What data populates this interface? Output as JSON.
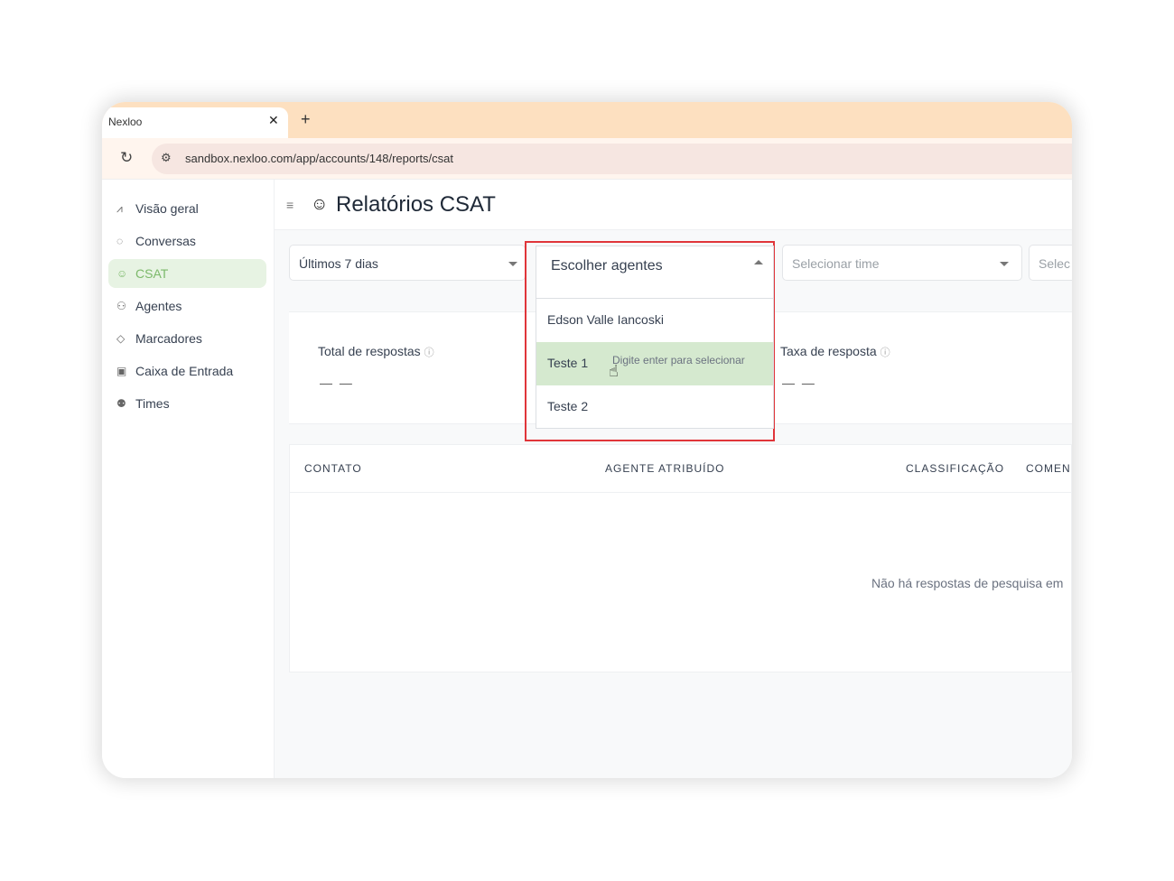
{
  "browser": {
    "tab_title": "Nexloo",
    "close_glyph": "✕",
    "new_tab_glyph": "+",
    "reload_glyph": "↻",
    "site_settings_glyph": "⚙",
    "url": "sandbox.nexloo.com/app/accounts/148/reports/csat"
  },
  "sidebar": {
    "items": [
      {
        "label": "Visão geral",
        "icon": "⩘"
      },
      {
        "label": "Conversas",
        "icon": "◌"
      },
      {
        "label": "CSAT",
        "icon": "☺"
      },
      {
        "label": "Agentes",
        "icon": "⚇"
      },
      {
        "label": "Marcadores",
        "icon": "◇"
      },
      {
        "label": "Caixa de Entrada",
        "icon": "▣"
      },
      {
        "label": "Times",
        "icon": "⚉"
      }
    ]
  },
  "header": {
    "menu_glyph": "≡",
    "title_icon": "☺",
    "title": "Relatórios CSAT"
  },
  "filters": {
    "date_range": "Últimos 7 dias",
    "team_placeholder": "Selecionar time",
    "extra_placeholder": "Selec"
  },
  "agents_dropdown": {
    "placeholder": "Escolher agentes",
    "options": [
      "Edson Valle Iancoski",
      "Teste 1",
      "Teste 2"
    ],
    "hover_hint": "Digite enter para selecionar",
    "cursor_glyph": "☝"
  },
  "metrics": {
    "total_label": "Total de respostas",
    "total_value": "— —",
    "rate_label": "Taxa de resposta",
    "rate_value": "— —",
    "info_glyph": "ⓘ"
  },
  "table": {
    "columns": [
      "CONTATO",
      "AGENTE ATRIBUÍDO",
      "CLASSIFICAÇÃO",
      "COMEN"
    ],
    "empty_message": "Não há respostas de pesquisa em"
  },
  "colors": {
    "active_green": "#7cb96a",
    "highlight_red": "#e0353a",
    "tabbar": "#fde0c0"
  }
}
